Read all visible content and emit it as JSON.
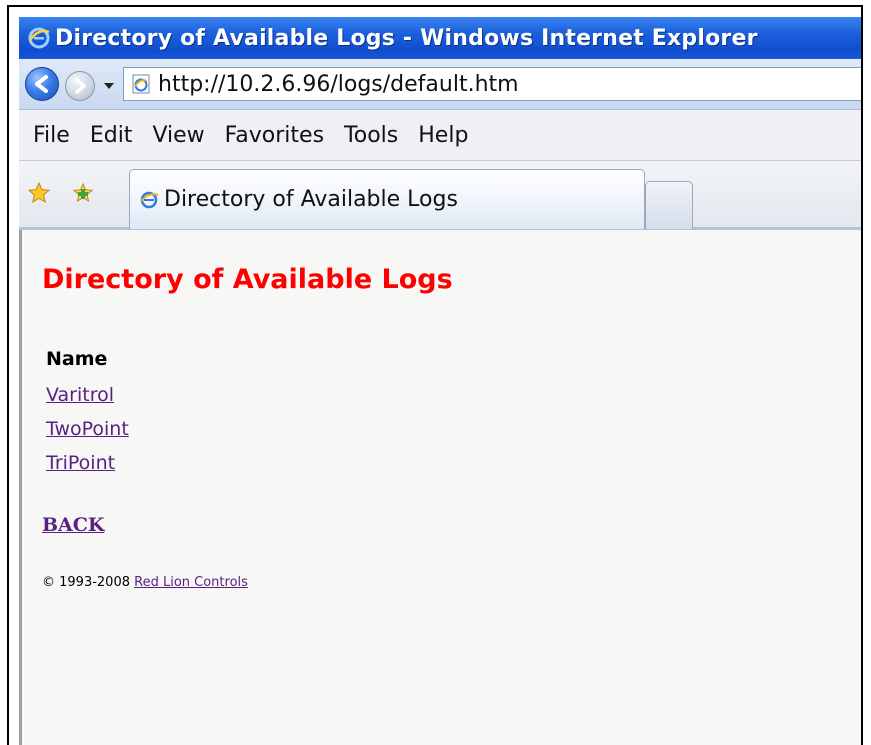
{
  "window": {
    "title": "Directory of Available Logs - Windows Internet Explorer"
  },
  "address_bar": {
    "url": "http://10.2.6.96/logs/default.htm"
  },
  "menu": {
    "items": [
      "File",
      "Edit",
      "View",
      "Favorites",
      "Tools",
      "Help"
    ]
  },
  "tabs": [
    {
      "label": "Directory of Available Logs",
      "active": true
    }
  ],
  "page": {
    "heading": "Directory of Available Logs",
    "column_header": "Name",
    "logs": [
      "Varitrol",
      "TwoPoint",
      "TriPoint"
    ],
    "back_label": "BACK",
    "footer_text": "© 1993-2008",
    "footer_link": "Red Lion Controls"
  },
  "icons": {
    "title_icon": "ie-logo-icon",
    "back": "back-arrow-icon",
    "forward": "forward-arrow-icon",
    "history": "chevron-down-icon",
    "page": "ie-page-icon",
    "favorites": "star-icon",
    "add_favorites": "add-star-icon"
  },
  "colors": {
    "heading": "#ff0000",
    "link": "#5a1f82",
    "titlebar": "#1b5fdc"
  }
}
